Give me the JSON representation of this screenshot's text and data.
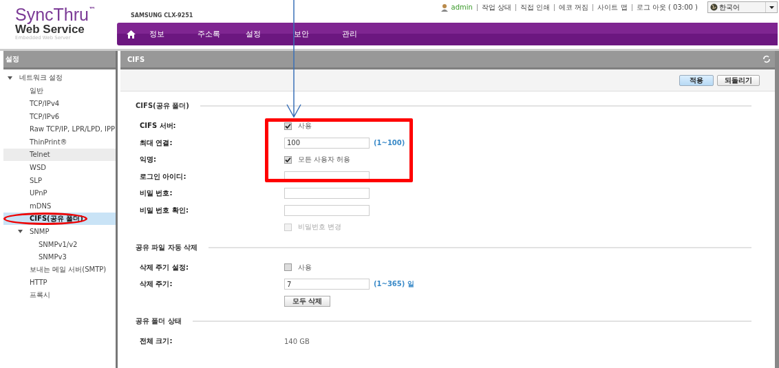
{
  "header": {
    "logo": {
      "title": "SyncThru",
      "mark": "™",
      "subtitle": "Web Service",
      "tagline": "Embedded Web Server"
    },
    "model": "SAMSUNG CLX-9251",
    "user": "admin",
    "links": [
      "작업 상태",
      "직접 인쇄",
      "에코 꺼짐",
      "사이트 맵",
      "로그 아웃 ( 03:00 )"
    ],
    "language": "한국어",
    "nav": [
      {
        "label": "정보",
        "selected": false
      },
      {
        "label": "주소록",
        "selected": false
      },
      {
        "label": "설정",
        "selected": false
      },
      {
        "label": "보안",
        "selected": false
      },
      {
        "label": "관리",
        "selected": false
      }
    ]
  },
  "sidebar": {
    "title": "설정",
    "tree": [
      {
        "label": "네트워크 설정",
        "expanded": true,
        "selected": false,
        "hovered": false,
        "children": [
          {
            "label": "일반",
            "selected": false,
            "hovered": false
          },
          {
            "label": "TCP/IPv4",
            "selected": false,
            "hovered": false
          },
          {
            "label": "TCP/IPv6",
            "selected": false,
            "hovered": false
          },
          {
            "label": "Raw TCP/IP, LPR/LPD, IPP",
            "selected": false,
            "hovered": false
          },
          {
            "label": "ThinPrint®",
            "selected": false,
            "hovered": false
          },
          {
            "label": "Telnet",
            "selected": false,
            "hovered": true
          },
          {
            "label": "WSD",
            "selected": false,
            "hovered": false
          },
          {
            "label": "SLP",
            "selected": false,
            "hovered": false
          },
          {
            "label": "UPnP",
            "selected": false,
            "hovered": false
          },
          {
            "label": "mDNS",
            "selected": false,
            "hovered": false
          },
          {
            "label": "CIFS(공유 폴더)",
            "selected": true,
            "hovered": false
          },
          {
            "label": "SNMP",
            "expanded": true,
            "selected": false,
            "hovered": false,
            "children": [
              {
                "label": "SNMPv1/v2",
                "selected": false,
                "hovered": false
              },
              {
                "label": "SNMPv3",
                "selected": false,
                "hovered": false
              }
            ]
          },
          {
            "label": "보내는 메일 서버(SMTP)",
            "selected": false,
            "hovered": false
          },
          {
            "label": "HTTP",
            "selected": false,
            "hovered": false
          },
          {
            "label": "프록시",
            "selected": false,
            "hovered": false
          }
        ]
      }
    ]
  },
  "content": {
    "title": "CIFS",
    "buttons": [
      {
        "label": "적용",
        "kind": "primary"
      },
      {
        "label": "되돌리기",
        "kind": "secondary"
      }
    ],
    "sections": [
      {
        "title": "CIFS(공유 폴더)",
        "rows": [
          {
            "kind": "checkbox",
            "label": "CIFS 서버:",
            "checked": true,
            "disabled": false,
            "text": "사용"
          },
          {
            "kind": "input",
            "label": "최대 연결:",
            "value": "100",
            "hint": "(1~100)"
          },
          {
            "kind": "checkbox",
            "label": "익명:",
            "checked": true,
            "disabled": false,
            "text": "모든 사용자 허용"
          },
          {
            "kind": "input",
            "label": "로그인 아이디:"
          },
          {
            "kind": "input",
            "label": "비밀 번호:"
          },
          {
            "kind": "input",
            "label": "비밀 번호 확인:"
          },
          {
            "kind": "checkbox",
            "checked": false,
            "disabled": true,
            "text": "비밀번호 변경"
          }
        ]
      },
      {
        "title": "공유 파일 자동 삭제",
        "rows": [
          {
            "kind": "checkbox",
            "label": "삭제 주기 설정:",
            "checked": false,
            "disabled": false,
            "text": "사용"
          },
          {
            "kind": "input",
            "label": "삭제 주기:",
            "value": "7",
            "hint": "(1~365) 일"
          },
          {
            "kind": "button",
            "text": "모두 삭제"
          }
        ]
      },
      {
        "title": "공유 폴더 상태",
        "rows": [
          {
            "kind": "info",
            "label": "전체 크기:",
            "value": "140 GB"
          }
        ]
      }
    ]
  }
}
